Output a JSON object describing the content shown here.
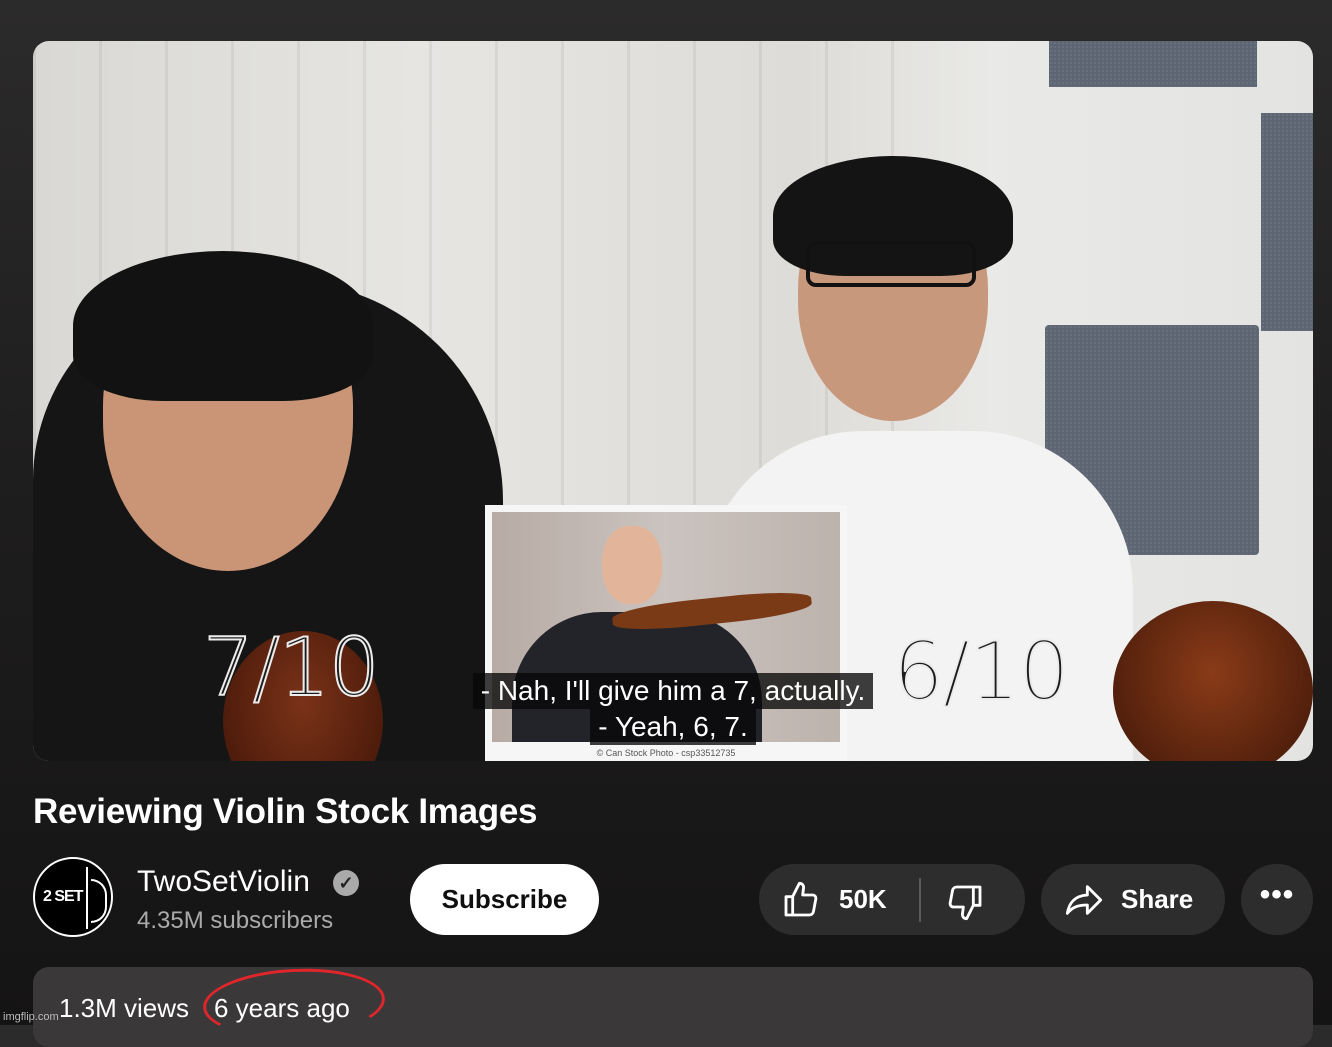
{
  "video": {
    "score_left": "7/10",
    "score_right": "6/10",
    "captions": [
      "- Nah, I'll give him a 7, actually.",
      "- Yeah, 6, 7."
    ],
    "stock_credit": "© Can Stock Photo - csp33512735",
    "stock_watermark": "Can Stock"
  },
  "title": "Reviewing Violin Stock Images",
  "channel": {
    "name": "TwoSetViolin",
    "subscribers": "4.35M subscribers",
    "avatar_text": "2 SET",
    "verified_icon": "verified-check-icon"
  },
  "actions": {
    "subscribe_label": "Subscribe",
    "like_count": "50K",
    "share_label": "Share",
    "more_label": "•••"
  },
  "description": {
    "views": "1.3M views",
    "age": "6 years ago"
  },
  "watermark": "imgflip.com",
  "colors": {
    "background": "#0f0f0f",
    "pill": "#2d2d2d",
    "annotation_red": "#e0262a"
  }
}
